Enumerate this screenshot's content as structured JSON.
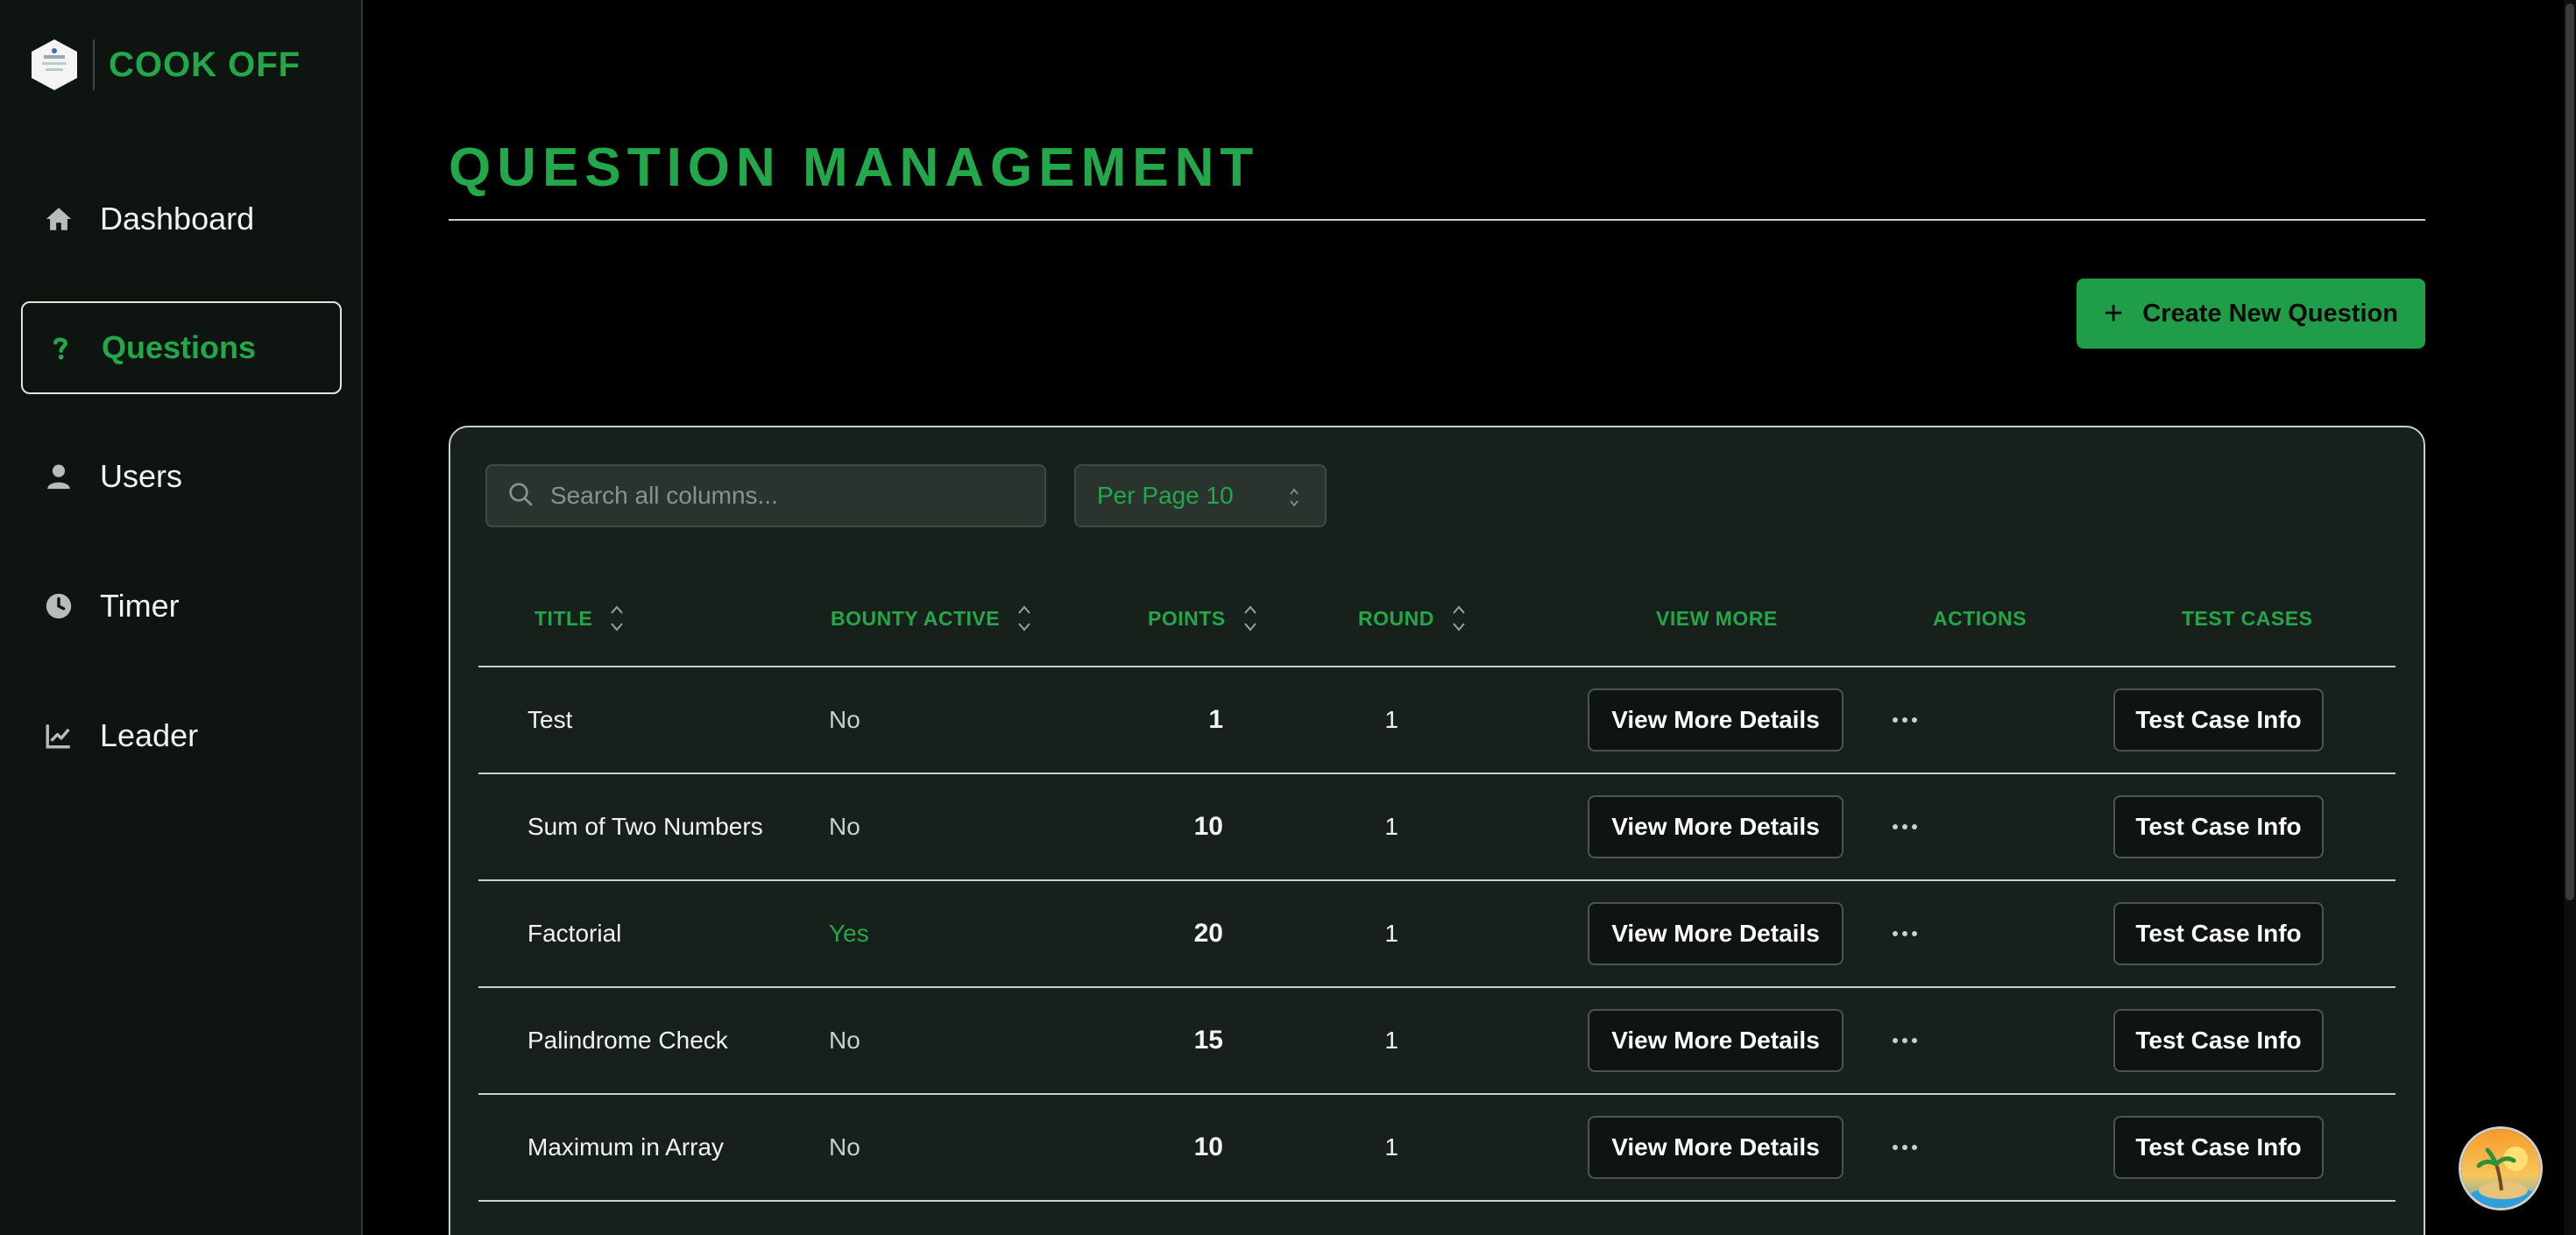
{
  "brand": {
    "name": "COOK OFF"
  },
  "sidebar": {
    "items": [
      {
        "label": "Dashboard",
        "icon": "home-icon"
      },
      {
        "label": "Questions",
        "icon": "question-icon",
        "active": true
      },
      {
        "label": "Users",
        "icon": "user-icon"
      },
      {
        "label": "Timer",
        "icon": "clock-icon"
      },
      {
        "label": "Leader",
        "icon": "chart-line-icon"
      }
    ]
  },
  "main": {
    "title": "QUESTION MANAGEMENT",
    "create_label": "Create New Question",
    "search_placeholder": "Search all columns...",
    "per_page_label": "Per Page 10",
    "columns": {
      "title": "TITLE",
      "bounty": "BOUNTY ACTIVE",
      "points": "POINTS",
      "round": "ROUND",
      "view_more": "VIEW MORE",
      "actions": "ACTIONS",
      "test_cases": "TEST CASES"
    },
    "view_more_label": "View More Details",
    "test_case_label": "Test Case Info",
    "rows": [
      {
        "title": "Test",
        "bounty": "No",
        "points": "1",
        "round": "1"
      },
      {
        "title": "Sum of Two Numbers",
        "bounty": "No",
        "points": "10",
        "round": "1"
      },
      {
        "title": "Factorial",
        "bounty": "Yes",
        "points": "20",
        "round": "1"
      },
      {
        "title": "Palindrome Check",
        "bounty": "No",
        "points": "15",
        "round": "1"
      },
      {
        "title": "Maximum in Array",
        "bounty": "No",
        "points": "10",
        "round": "1"
      }
    ]
  },
  "colors": {
    "accent": "#22a84a",
    "button_green": "#1f9d48",
    "card_bg": "#18201b",
    "sidebar_bg": "#0e1510"
  }
}
